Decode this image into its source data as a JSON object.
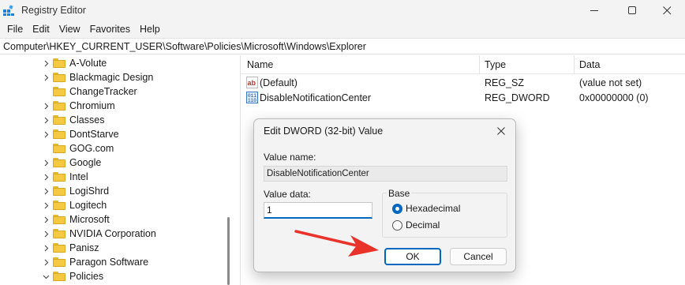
{
  "window": {
    "title": "Registry Editor",
    "minimize_icon": "minimize-icon",
    "maximize_icon": "maximize-icon",
    "close_icon": "close-icon"
  },
  "menu": [
    "File",
    "Edit",
    "View",
    "Favorites",
    "Help"
  ],
  "address": "Computer\\HKEY_CURRENT_USER\\Software\\Policies\\Microsoft\\Windows\\Explorer",
  "tree": {
    "items": [
      {
        "label": "A-Volute",
        "expand": "collapsed"
      },
      {
        "label": "Blackmagic Design",
        "expand": "collapsed"
      },
      {
        "label": "ChangeTracker",
        "expand": "none"
      },
      {
        "label": "Chromium",
        "expand": "collapsed"
      },
      {
        "label": "Classes",
        "expand": "collapsed"
      },
      {
        "label": "DontStarve",
        "expand": "collapsed"
      },
      {
        "label": "GOG.com",
        "expand": "none"
      },
      {
        "label": "Google",
        "expand": "collapsed"
      },
      {
        "label": "Intel",
        "expand": "collapsed"
      },
      {
        "label": "LogiShrd",
        "expand": "collapsed"
      },
      {
        "label": "Logitech",
        "expand": "collapsed"
      },
      {
        "label": "Microsoft",
        "expand": "collapsed"
      },
      {
        "label": "NVIDIA Corporation",
        "expand": "collapsed"
      },
      {
        "label": "Panisz",
        "expand": "collapsed"
      },
      {
        "label": "Paragon Software",
        "expand": "collapsed"
      },
      {
        "label": "Policies",
        "expand": "expanded"
      }
    ]
  },
  "list": {
    "columns": [
      "Name",
      "Type",
      "Data"
    ],
    "rows": [
      {
        "icon": "string-value-icon",
        "name": "(Default)",
        "type": "REG_SZ",
        "data": "(value not set)"
      },
      {
        "icon": "binary-value-icon",
        "name": "DisableNotificationCenter",
        "type": "REG_DWORD",
        "data": "0x00000000 (0)"
      }
    ]
  },
  "dialog": {
    "title": "Edit DWORD (32-bit) Value",
    "value_name_label": "Value name:",
    "value_name": "DisableNotificationCenter",
    "value_data_label": "Value data:",
    "value_data": "1",
    "base_label": "Base",
    "base_options": [
      {
        "label": "Hexadecimal",
        "selected": true
      },
      {
        "label": "Decimal",
        "selected": false
      }
    ],
    "ok_label": "OK",
    "cancel_label": "Cancel"
  },
  "colors": {
    "accent": "#0067c0",
    "annotation_arrow": "#e8322a"
  }
}
